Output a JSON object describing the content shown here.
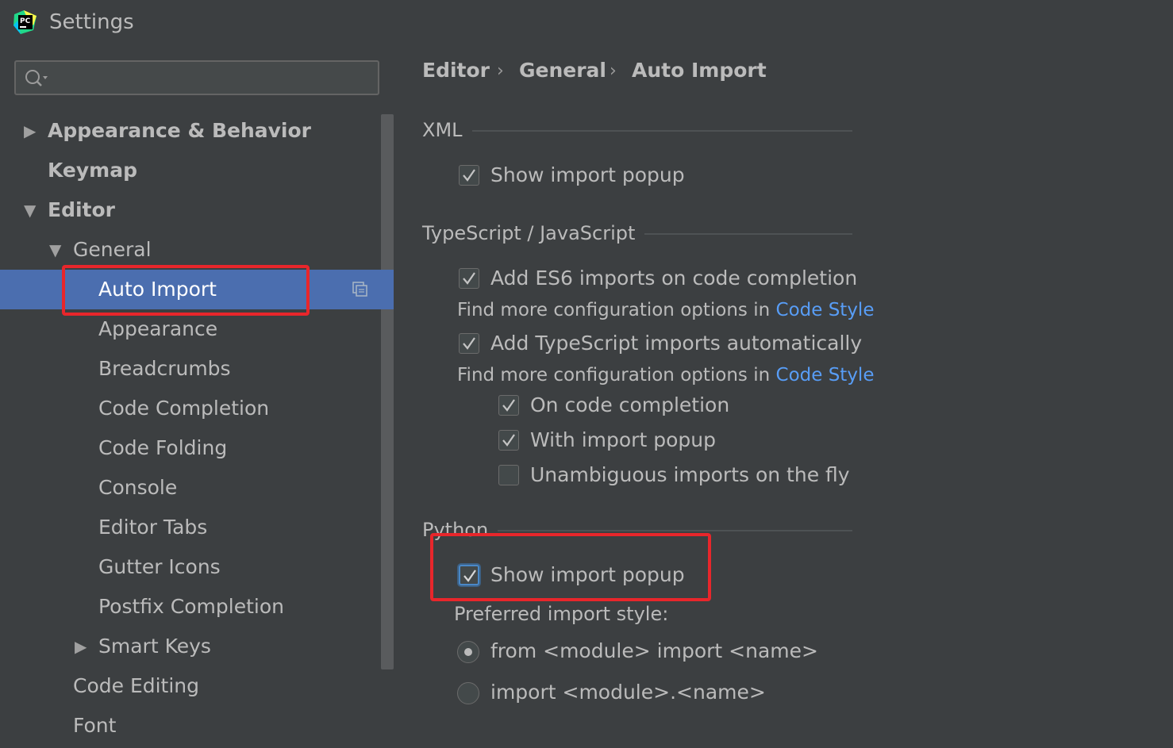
{
  "window": {
    "title": "Settings",
    "app_badge": "PC"
  },
  "search": {
    "value": "",
    "placeholder": ""
  },
  "tree": [
    {
      "label": "Appearance & Behavior",
      "arrow": "▶",
      "bold": true
    },
    {
      "label": "Keymap",
      "arrow": "",
      "bold": true
    },
    {
      "label": "Editor",
      "arrow": "▼",
      "bold": true
    },
    {
      "label": "General",
      "arrow": "▼",
      "bold": false
    },
    {
      "label": "Auto Import",
      "arrow": "",
      "bold": false,
      "selected": true
    },
    {
      "label": "Appearance",
      "arrow": "",
      "bold": false
    },
    {
      "label": "Breadcrumbs",
      "arrow": "",
      "bold": false
    },
    {
      "label": "Code Completion",
      "arrow": "",
      "bold": false
    },
    {
      "label": "Code Folding",
      "arrow": "",
      "bold": false
    },
    {
      "label": "Console",
      "arrow": "",
      "bold": false
    },
    {
      "label": "Editor Tabs",
      "arrow": "",
      "bold": false
    },
    {
      "label": "Gutter Icons",
      "arrow": "",
      "bold": false
    },
    {
      "label": "Postfix Completion",
      "arrow": "",
      "bold": false
    },
    {
      "label": "Smart Keys",
      "arrow": "▶",
      "bold": false
    },
    {
      "label": "Code Editing",
      "arrow": "",
      "bold": false
    },
    {
      "label": "Font",
      "arrow": "",
      "bold": false
    }
  ],
  "breadcrumb": [
    "Editor",
    "General",
    "Auto Import"
  ],
  "breadcrumb_separator": "›",
  "sections": {
    "xml": {
      "title": "XML",
      "show_import_popup": {
        "label": "Show import popup",
        "checked": true
      }
    },
    "ts": {
      "title": "TypeScript / JavaScript",
      "add_es6": {
        "label": "Add ES6 imports on code completion",
        "checked": true
      },
      "hint1_text": "Find more configuration options in ",
      "hint1_link": "Code Style",
      "add_ts": {
        "label": "Add TypeScript imports automatically",
        "checked": true
      },
      "hint2_text": "Find more configuration options in ",
      "hint2_link": "Code Style",
      "on_completion": {
        "label": "On code completion",
        "checked": true
      },
      "with_popup": {
        "label": "With import popup",
        "checked": true
      },
      "unambiguous": {
        "label": "Unambiguous imports on the fly",
        "checked": false
      }
    },
    "python": {
      "title": "Python",
      "show_import_popup": {
        "label": "Show import popup",
        "checked": true
      },
      "preferred_style_label": "Preferred import style:",
      "from_import": {
        "label": "from <module> import <name>",
        "selected": true
      },
      "import_module": {
        "label": "import <module>.<name>",
        "selected": false
      }
    }
  },
  "colors": {
    "background": "#3c3f41",
    "selection": "#4b6eaf",
    "link": "#589df6",
    "highlight_box": "#e8262b"
  }
}
